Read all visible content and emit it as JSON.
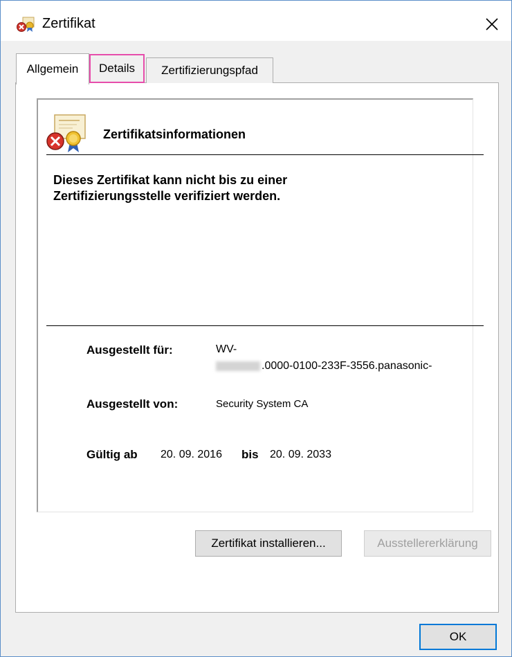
{
  "window": {
    "title": "Zertifikat",
    "close_symbol": "✕",
    "icons": {
      "title": "certificate-error-icon",
      "close": "close-icon"
    }
  },
  "tabs": [
    {
      "label": "Allgemein",
      "selected": true
    },
    {
      "label": "Details",
      "selected": false,
      "highlighted": true
    },
    {
      "label": "Zertifizierungspfad",
      "selected": false
    }
  ],
  "general": {
    "heading": "Zertifikatsinformationen",
    "warning_line1": "Dieses Zertifikat kann nicht bis zu einer",
    "warning_line2": "Zertifizierungsstelle verifiziert werden.",
    "issued_to_label": "Ausgestellt für:",
    "issued_to_value_line1": "WV-",
    "issued_to_value_line2": ".0000-0100-233F-3556.panasonic-",
    "issued_by_label": "Ausgestellt von:",
    "issued_by_value": "Security System CA",
    "valid_from_label": "Gültig ab",
    "valid_from_value": "20. 09. 2016",
    "valid_to_label": "bis",
    "valid_to_value": "20. 09. 2033"
  },
  "buttons": {
    "install": "Zertifikat installieren...",
    "issuer_statement": "Ausstellererklärung",
    "ok": "OK"
  },
  "colors": {
    "highlight": "#e64dab",
    "window_border": "#5b8ec9",
    "focus": "#0078d7"
  }
}
